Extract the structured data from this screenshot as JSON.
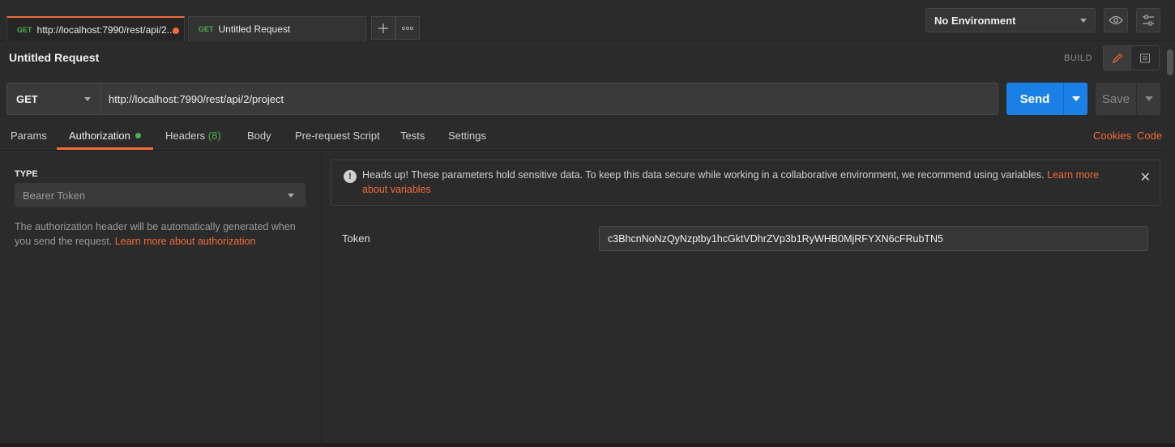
{
  "tabs": [
    {
      "method": "GET",
      "label": "http://localhost:7990/rest/api/2...",
      "unsaved": true
    },
    {
      "method": "GET",
      "label": "Untitled Request",
      "unsaved": false
    }
  ],
  "tab_actions": {
    "add_icon": "plus-icon",
    "more_icon": "more-icon"
  },
  "environment": {
    "selected": "No Environment",
    "eye_icon": "eye-icon",
    "settings_icon": "sliders-icon"
  },
  "request": {
    "title": "Untitled Request",
    "mode_label": "BUILD",
    "method": "GET",
    "url": "http://localhost:7990/rest/api/2/project",
    "send_label": "Send",
    "save_label": "Save"
  },
  "subtabs": {
    "params": "Params",
    "authorization": "Authorization",
    "headers": "Headers",
    "headers_count": "(8)",
    "body": "Body",
    "prerequest": "Pre-request Script",
    "tests": "Tests",
    "settings": "Settings",
    "cookies": "Cookies",
    "code": "Code"
  },
  "auth": {
    "type_label": "TYPE",
    "type_value": "Bearer Token",
    "description": "The authorization header will be automatically generated when you send the request. ",
    "description_link": "Learn more about authorization"
  },
  "notice": {
    "text": "Heads up! These parameters hold sensitive data. To keep this data secure while working in a collaborative environment, we recommend using variables. ",
    "link": "Learn more about variables"
  },
  "token": {
    "label": "Token",
    "value": "c3BhcnNoNzQyNzptby1hcGktVDhrZVp3b1RyWHB0MjRFYXN6cFRubTN5"
  },
  "colors": {
    "accent": "#f26b3a",
    "send": "#1a80e6",
    "status_green": "#4caf50"
  }
}
